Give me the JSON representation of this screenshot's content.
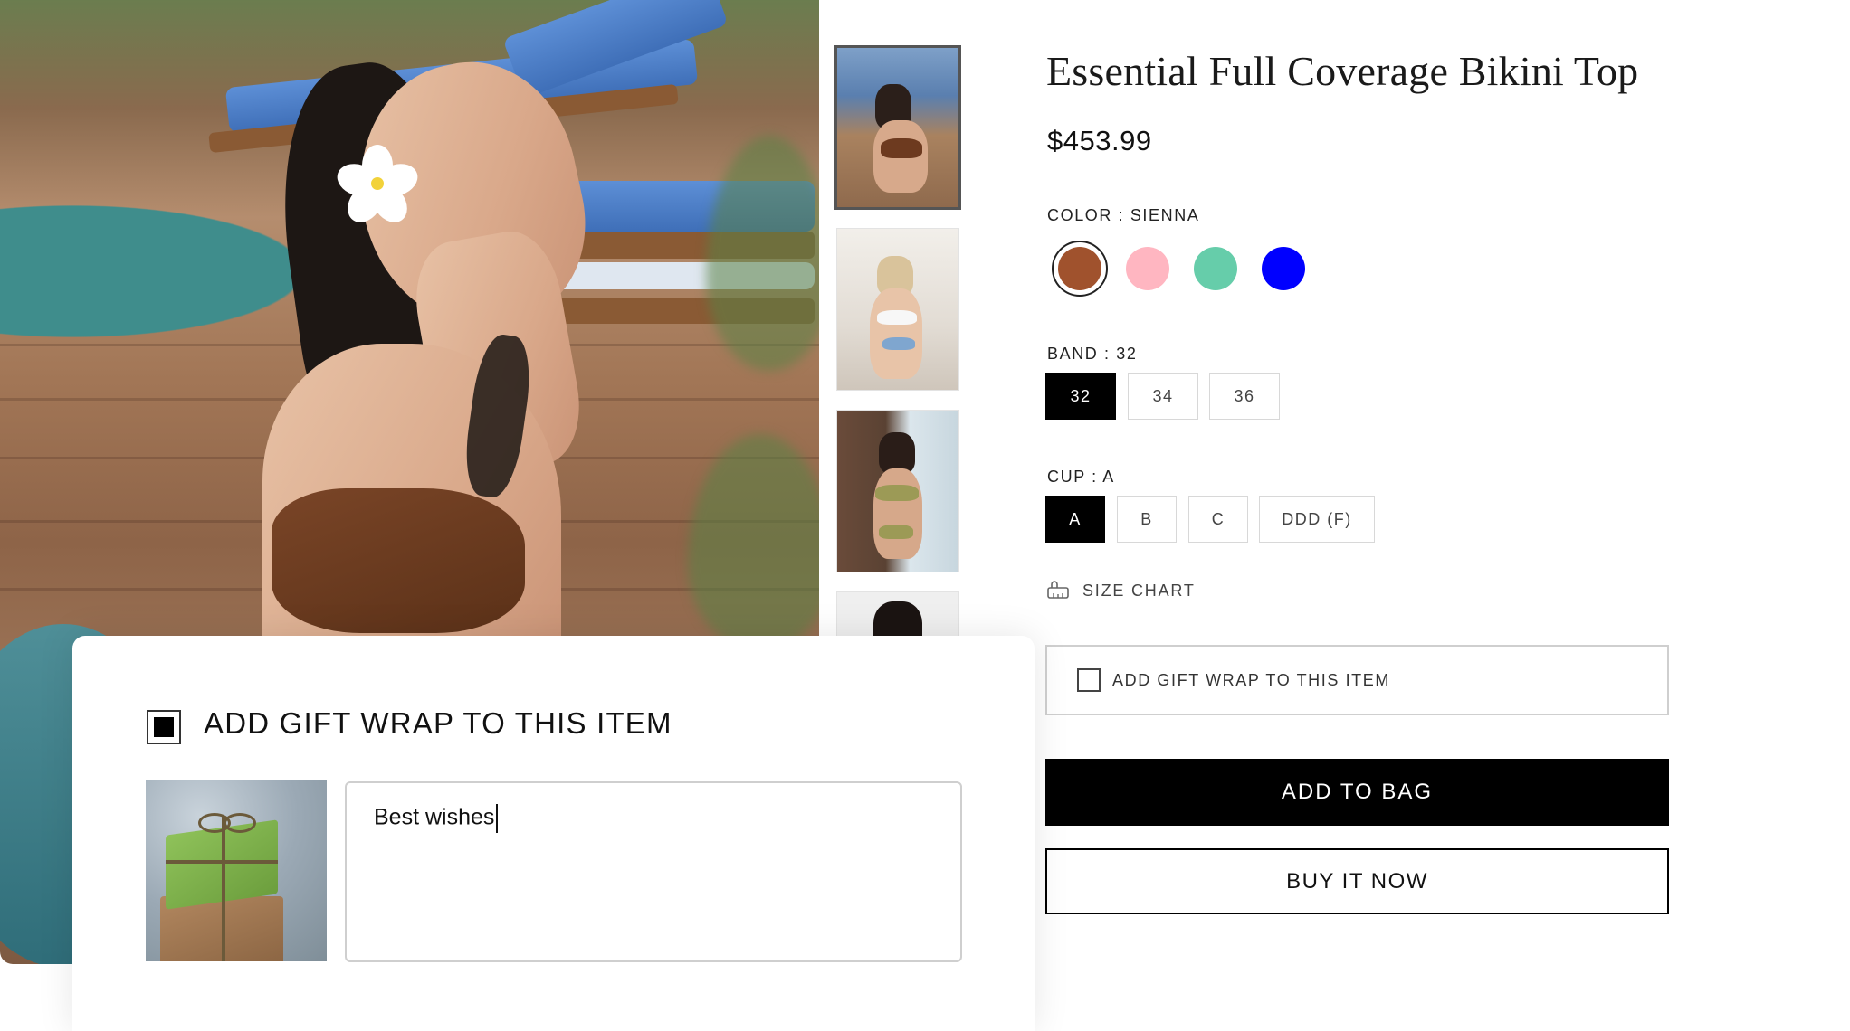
{
  "product": {
    "title": "Essential Full Coverage Bikini Top",
    "price": "$453.99"
  },
  "color": {
    "label": "COLOR : SIENNA",
    "swatches": [
      {
        "name": "Sienna",
        "hex": "#A0522D",
        "selected": true
      },
      {
        "name": "Pink",
        "hex": "#FFB6C1",
        "selected": false
      },
      {
        "name": "Mint",
        "hex": "#66CDAA",
        "selected": false
      },
      {
        "name": "Blue",
        "hex": "#0000FF",
        "selected": false
      }
    ]
  },
  "band": {
    "label": "BAND : 32",
    "options": [
      "32",
      "34",
      "36"
    ],
    "selected": "32"
  },
  "cup": {
    "label": "CUP : A",
    "options": [
      "A",
      "B",
      "C",
      "DDD (F)"
    ],
    "selected": "A"
  },
  "size_chart": {
    "label": "SIZE CHART",
    "icon": "ruler-icon"
  },
  "gift_wrap": {
    "label": "ADD GIFT WRAP TO THIS ITEM",
    "checked_small": false,
    "checked_zoomed": true,
    "message_value": "Best wishes"
  },
  "actions": {
    "add_to_bag": "ADD TO BAG",
    "buy_now": "BUY IT NOW"
  },
  "gallery": {
    "thumbnail_count": 4,
    "active_index": 0
  }
}
